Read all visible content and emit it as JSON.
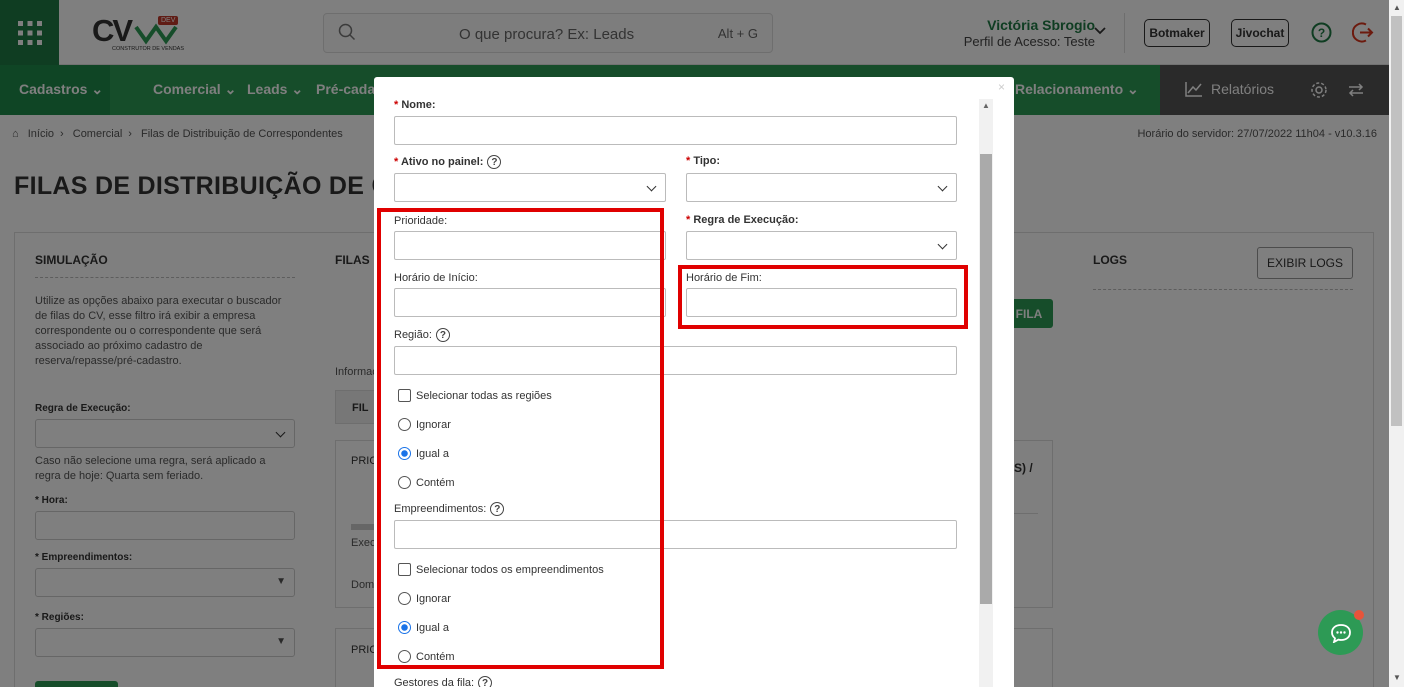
{
  "header": {
    "logo_text": "CV",
    "logo_badge": "DEV",
    "logo_sub": "CONSTRUTOR DE VENDAS",
    "search_placeholder": "O que procura? Ex: Leads",
    "search_shortcut": "Alt + G",
    "user_name": "Victória Sbrogio",
    "user_profile": "Perfil de Acesso: Teste",
    "btn_botmaker": "Botmaker",
    "btn_jivochat": "Jivochat"
  },
  "nav": {
    "items": [
      "Cadastros",
      "Comercial",
      "Leads",
      "Pré-cadas",
      "Relacionamento"
    ],
    "relatorios": "Relatórios"
  },
  "breadcrumb": [
    "Início",
    "Comercial",
    "Filas de Distribuição de Correspondentes"
  ],
  "server_time": "Horário do servidor: 27/07/2022 11h04 - v10.3.16",
  "page_title": "FILAS DE DISTRIBUIÇÃO DE CO",
  "simulacao": {
    "title": "SIMULAÇÃO",
    "desc": "Utilize as opções abaixo para executar o buscador de filas do CV, esse filtro irá exibir a empresa correspondente ou o correspondente que será associado ao próximo cadastro de reserva/repasse/pré-cadastro.",
    "regra_label": "Regra de Execução:",
    "regra_hint": "Caso não selecione uma regra, será aplicado a regra de hoje: Quarta sem feriado.",
    "hora_label": "* Hora:",
    "emp_label": "* Empreendimentos:",
    "reg_label": "* Regiões:"
  },
  "filas": {
    "title": "FILAS",
    "info": "Informaç",
    "filter": "FIL",
    "prio1": "PRIO",
    "exec": "Exec",
    "dom": "Dom",
    "prio2": "PRIO",
    "suffix": "S) /",
    "add_btn": "FILA"
  },
  "logs": {
    "title": "LOGS",
    "exibir": "EXIBIR LOGS"
  },
  "modal": {
    "nome": "Nome:",
    "ativo": "Ativo no painel:",
    "tipo": "Tipo:",
    "prioridade": "Prioridade:",
    "regra": "Regra de Execução:",
    "hora_inicio": "Horário de Início:",
    "hora_fim": "Horário de Fim:",
    "regiao": "Região:",
    "sel_regioes": "Selecionar todas as regiões",
    "emp": "Empreendimentos:",
    "sel_emp": "Selecionar todos os empreendimentos",
    "ignorar": "Ignorar",
    "igual": "Igual a",
    "contem": "Contém",
    "gestores": "Gestores da fila:",
    "close": "×"
  },
  "colors": {
    "green": "#2d9a55",
    "dark_green": "#1e7a44",
    "highlight": "#e00000"
  }
}
